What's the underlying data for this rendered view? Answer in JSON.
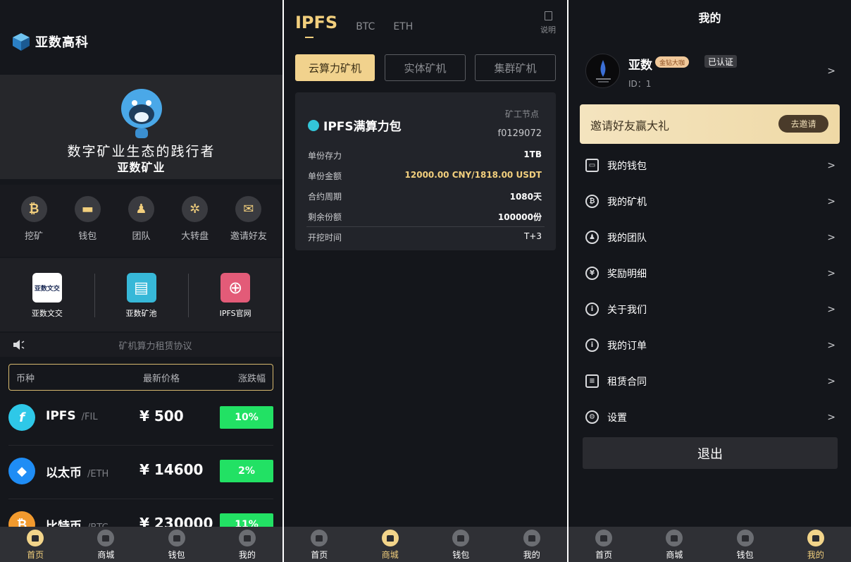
{
  "home": {
    "brand": "亚数高科",
    "hero_line1": "数字矿业生态的践行者",
    "hero_line2": "亚数矿业",
    "quick": [
      {
        "label": "挖矿",
        "glyph": "₿"
      },
      {
        "label": "钱包",
        "glyph": "▬"
      },
      {
        "label": "团队",
        "glyph": "♟"
      },
      {
        "label": "大转盘",
        "glyph": "✲"
      },
      {
        "label": "邀请好友",
        "glyph": "✉"
      }
    ],
    "links": [
      {
        "label": "亚数文交",
        "box_text": "亚数文交",
        "color": "#ffffff"
      },
      {
        "label": "亚数矿池",
        "box_text": "▤",
        "color": "#37b8d8"
      },
      {
        "label": "IPFS官网",
        "box_text": "⊕",
        "color": "#e35b78"
      }
    ],
    "notice": "矿机算力租赁协议",
    "market_header": {
      "coin": "币种",
      "price": "最新价格",
      "change": "涨跌幅"
    },
    "market": [
      {
        "name": "IPFS",
        "symbol": "/FIL",
        "price": "¥ 500",
        "change": "10%",
        "icon": "f",
        "icon_color": "#2ec8e8"
      },
      {
        "name": "以太币",
        "symbol": "/ETH",
        "price": "¥ 14600",
        "change": "2%",
        "icon": "◆",
        "icon_color": "#1f8df5"
      },
      {
        "name": "比特币",
        "symbol": "/BTC",
        "price": "¥ 230000",
        "change": "11%",
        "icon": "₿",
        "icon_color": "#f29a2e"
      }
    ]
  },
  "shop": {
    "tabs": [
      "IPFS",
      "BTC",
      "ETH"
    ],
    "explain": "说明",
    "segments": [
      "云算力矿机",
      "实体矿机",
      "集群矿机"
    ],
    "card": {
      "title": "IPFS满算力包",
      "node_label": "矿工节点",
      "node_value": "f0129072",
      "rows": [
        {
          "k": "单份存力",
          "v": "1TB",
          "gold": false
        },
        {
          "k": "单份金额",
          "v": "12000.00 CNY/1818.00 USDT",
          "gold": true
        },
        {
          "k": "合约周期",
          "v": "1080天",
          "gold": false
        },
        {
          "k": "剩余份额",
          "v": "100000份",
          "gold": false
        }
      ],
      "start_label": "开挖时间",
      "start_value": "T+3"
    }
  },
  "mine": {
    "title": "我的",
    "user": {
      "name": "亚数",
      "level": "金钻大咖",
      "verified": "已认证",
      "id": "ID：1"
    },
    "invite": {
      "text": "邀请好友赢大礼",
      "button": "去邀请"
    },
    "menu": [
      {
        "label": "我的钱包",
        "icon": "▭",
        "sq": true
      },
      {
        "label": "我的矿机",
        "icon": "₿",
        "sq": false
      },
      {
        "label": "我的团队",
        "icon": "♟",
        "sq": false
      },
      {
        "label": "奖励明细",
        "icon": "¥",
        "sq": false
      },
      {
        "label": "关于我们",
        "icon": "i",
        "sq": false
      },
      {
        "label": "我的订单",
        "icon": "i",
        "sq": false
      },
      {
        "label": "租赁合同",
        "icon": "≡",
        "sq": true
      },
      {
        "label": "设置",
        "icon": "⚙",
        "sq": false
      }
    ],
    "logout": "退出"
  },
  "tabbar": [
    "首页",
    "商城",
    "钱包",
    "我的"
  ],
  "chevron": ">"
}
